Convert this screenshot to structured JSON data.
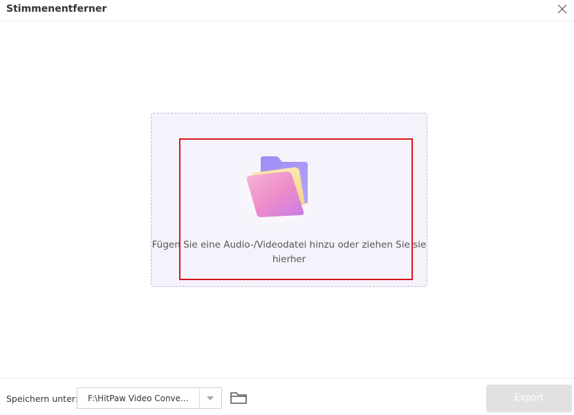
{
  "window": {
    "title": "Stimmenentferner"
  },
  "dropzone": {
    "text": "Fügen Sie eine Audio-/Videodatei hinzu oder ziehen Sie sie hierher",
    "icon": "folder-icon"
  },
  "footer": {
    "save_label": "Speichern unter:",
    "path_value": "F:\\HitPaw Video Conve...",
    "folder_icon": "folder-outline-icon",
    "export_label": "Export",
    "export_enabled": false
  },
  "colors": {
    "highlight": "#d6151c",
    "dropzone_bg": "#f5f2fb",
    "dropzone_border": "#c5b7dd",
    "export_disabled_bg": "#e1e1e1"
  }
}
